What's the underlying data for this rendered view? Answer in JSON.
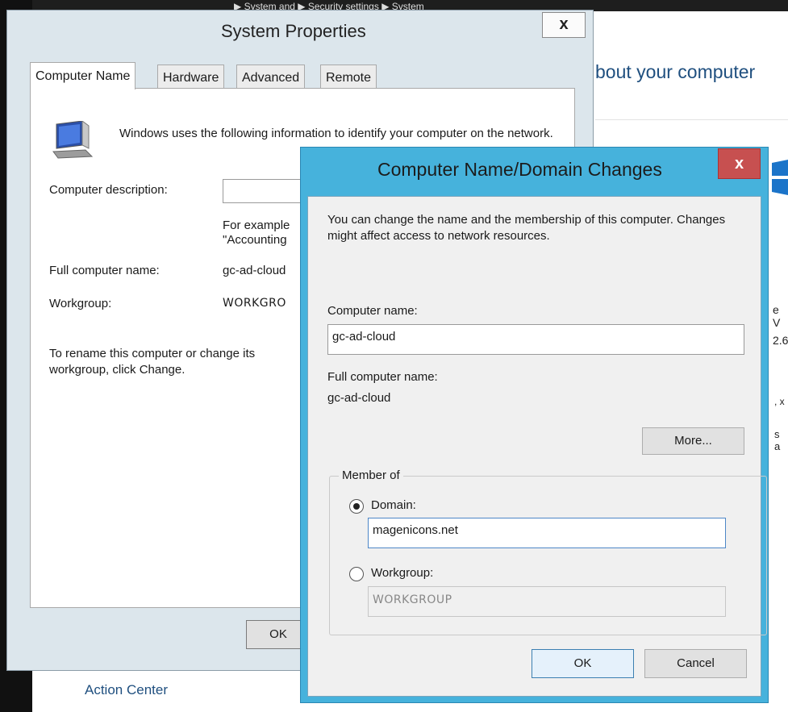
{
  "background": {
    "top_strip_text": "▶ System and ▶ Security settings ▶ System",
    "heading": "bout your computer",
    "fragments": [
      "e V",
      "2.6",
      ", x",
      "s a"
    ],
    "action_center": "Action Center"
  },
  "system_properties": {
    "title": "System Properties",
    "close_glyph": "x",
    "tabs": [
      "Computer Name",
      "Hardware",
      "Advanced",
      "Remote"
    ],
    "intro": "Windows uses the following information to identify your computer on the network.",
    "description_label": "Computer description:",
    "description_value": "",
    "example_text_line1": "For example",
    "example_text_line2": "\"Accounting",
    "full_name_label": "Full computer name:",
    "full_name_value": "gc-ad-cloud",
    "workgroup_label": "Workgroup:",
    "workgroup_value": "WORKGRO",
    "rename_text": "To rename this computer or change its workgroup, click Change.",
    "ok_label": "OK"
  },
  "domain_changes": {
    "title": "Computer Name/Domain Changes",
    "close_glyph": "x",
    "intro": "You can change the name and the membership of this computer. Changes might affect access to network resources.",
    "computer_name_label": "Computer name:",
    "computer_name_value": "gc-ad-cloud",
    "full_name_label": "Full computer name:",
    "full_name_value": "gc-ad-cloud",
    "more_label": "More...",
    "member_of_label": "Member of",
    "domain_label": "Domain:",
    "domain_value": "magenicons.net",
    "domain_selected": true,
    "workgroup_label": "Workgroup:",
    "workgroup_value": "WORKGROUP",
    "ok_label": "OK",
    "cancel_label": "Cancel"
  },
  "colors": {
    "dialog_frame": "#46b2dc",
    "close_button": "#c75050",
    "link_blue": "#1f4f7f"
  }
}
